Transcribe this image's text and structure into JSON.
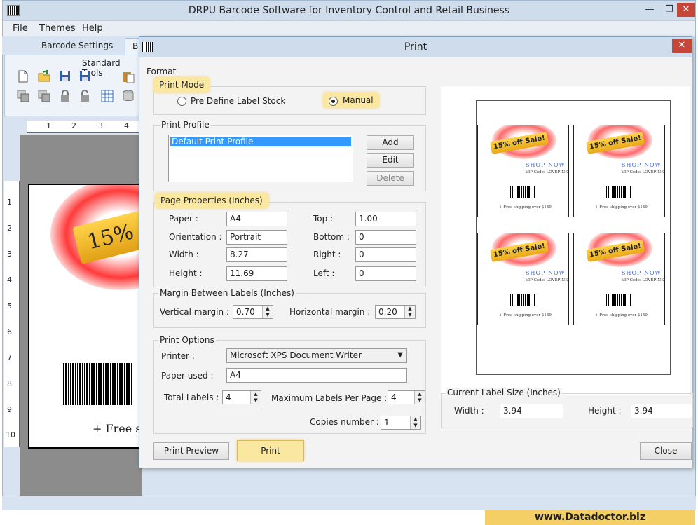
{
  "app": {
    "title": "DRPU Barcode Software for Inventory Control and Retail Business",
    "window_controls": {
      "minimize": "—",
      "maximize": "❐",
      "close": "✕"
    }
  },
  "menu": [
    {
      "label": "File"
    },
    {
      "label": "Themes"
    },
    {
      "label": "Help"
    }
  ],
  "tabs": [
    {
      "label": "Barcode Settings"
    },
    {
      "label": "Ba"
    }
  ],
  "toolbar": {
    "title": "Standard Tools"
  },
  "ruler": {
    "h": [
      "1",
      "2",
      "3",
      "4"
    ],
    "v": [
      "1",
      "2",
      "3",
      "4",
      "5",
      "6",
      "7",
      "8",
      "9",
      "10"
    ]
  },
  "canvas_label": {
    "ribbon_text": "15%",
    "footer_text": "+ Free sh"
  },
  "footer_badge": "www.Datadoctor.biz",
  "dialog": {
    "title": "Print",
    "close": "✕",
    "format_label": "Format",
    "print_mode": {
      "label": "Print Mode",
      "option_predefine": "Pre Define Label Stock",
      "option_manual": "Manual",
      "selected": "Manual"
    },
    "print_profile": {
      "label": "Print Profile",
      "items": [
        "Default Print Profile"
      ],
      "selected": "Default Print Profile",
      "add": "Add",
      "edit": "Edit",
      "delete": "Delete"
    },
    "page_properties": {
      "label": "Page Properties (Inches)",
      "paper_label": "Paper :",
      "paper": "A4",
      "orientation_label": "Orientation :",
      "orientation": "Portrait",
      "width_label": "Width :",
      "width": "8.27",
      "height_label": "Height :",
      "height": "11.69",
      "top_label": "Top :",
      "top": "1.00",
      "bottom_label": "Bottom :",
      "bottom": "0",
      "right_label": "Right :",
      "right": "0",
      "left_label": "Left :",
      "left": "0"
    },
    "margin": {
      "label": "Margin Between Labels (Inches)",
      "vertical_label": "Vertical margin :",
      "vertical": "0.70",
      "horizontal_label": "Horizontal margin :",
      "horizontal": "0.20"
    },
    "print_options": {
      "label": "Print Options",
      "printer_label": "Printer :",
      "printer": "Microsoft XPS Document Writer",
      "paper_used_label": "Paper used :",
      "paper_used": "A4",
      "total_labels_label": "Total Labels :",
      "total_labels": "4",
      "max_per_page_label": "Maximum Labels Per Page :",
      "max_per_page": "4",
      "copies_label": "Copies number :",
      "copies": "1"
    },
    "preview": {
      "sale_text": "15% off Sale!",
      "shop_text": "SHOP NOW",
      "vip_text": "VIP Code: LOVEPINK",
      "ship_text": "+ Free shipping over $149",
      "label_count": 4
    },
    "current_size": {
      "label": "Current Label Size (Inches)",
      "width_label": "Width :",
      "width": "3.94",
      "height_label": "Height :",
      "height": "3.94"
    },
    "buttons": {
      "print_preview": "Print Preview",
      "print": "Print",
      "close": "Close"
    }
  }
}
